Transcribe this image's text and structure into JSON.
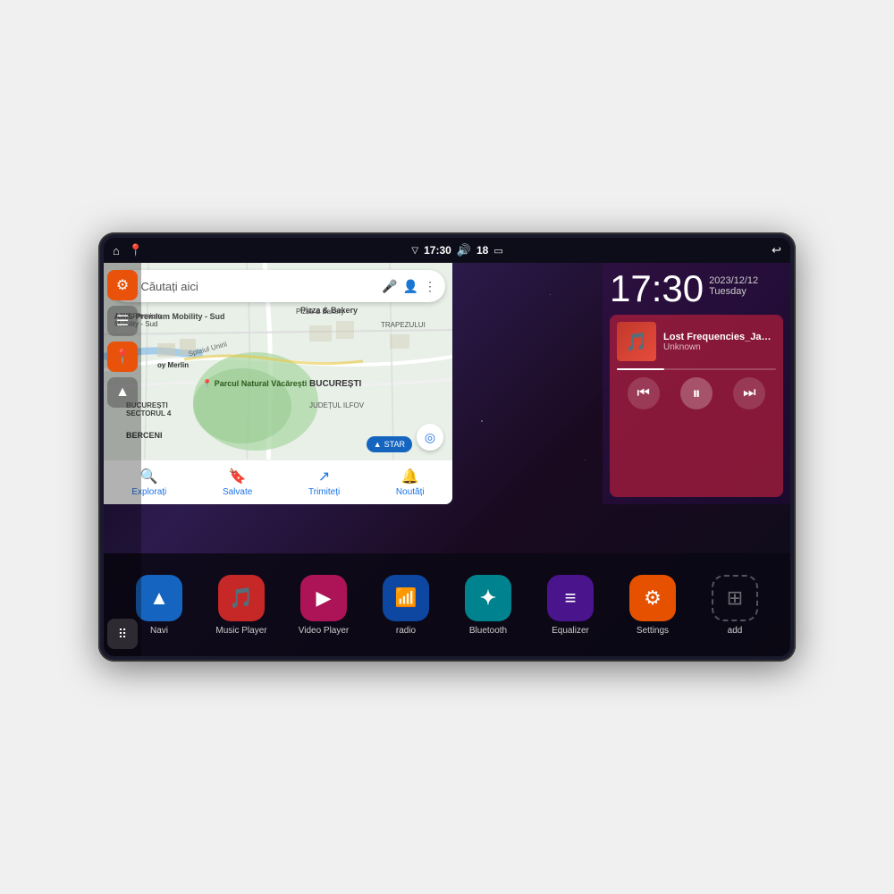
{
  "device": {
    "screen_bg": "#0d0d1a"
  },
  "status_bar": {
    "wifi_icon": "▼",
    "time": "17:30",
    "volume_icon": "🔊",
    "battery_level": "18",
    "battery_icon": "🔋",
    "back_icon": "↩",
    "home_icon": "⌂",
    "maps_icon": "📍"
  },
  "clock": {
    "time": "17:30",
    "date": "2023/12/12",
    "day": "Tuesday"
  },
  "music": {
    "title": "Lost Frequencies_Janie...",
    "artist": "Unknown",
    "album_art_icon": "🎵",
    "progress_percent": 30
  },
  "map": {
    "search_placeholder": "Căutați aici",
    "location1": "AXIS Premium Mobility - Sud",
    "location2": "Pizza & Bakery",
    "location3": "Parcul Natural Văcărești",
    "location4": "BUCUREȘTI",
    "location5": "SECTORUL 4",
    "location6": "BERCENI",
    "location7": "JUDEȚUL ILFOV",
    "location8": "TRAPEZULUI",
    "bottom_btn1": "Explorați",
    "bottom_btn2": "Salvate",
    "bottom_btn3": "Trimiteți",
    "bottom_btn4": "Noutăți"
  },
  "apps": [
    {
      "id": "navi",
      "label": "Navi",
      "icon": "▲",
      "color": "blue"
    },
    {
      "id": "music-player",
      "label": "Music Player",
      "icon": "🎵",
      "color": "red"
    },
    {
      "id": "video-player",
      "label": "Video Player",
      "icon": "▶",
      "color": "pink"
    },
    {
      "id": "radio",
      "label": "radio",
      "icon": "📶",
      "color": "dark-blue"
    },
    {
      "id": "bluetooth",
      "label": "Bluetooth",
      "icon": "✦",
      "color": "cyan"
    },
    {
      "id": "equalizer",
      "label": "Equalizer",
      "icon": "≡",
      "color": "purple-eq"
    },
    {
      "id": "settings",
      "label": "Settings",
      "icon": "⚙",
      "color": "orange-set"
    },
    {
      "id": "add",
      "label": "add",
      "icon": "⊞",
      "color": "gray-add"
    }
  ],
  "sidebar": {
    "settings_icon": "⚙",
    "files_icon": "☰",
    "maps_icon": "📍",
    "navi_icon": "▲",
    "grid_icon": "⋮⋮"
  },
  "music_controls": {
    "prev": "⏮",
    "pause": "⏸",
    "next": "⏭"
  }
}
